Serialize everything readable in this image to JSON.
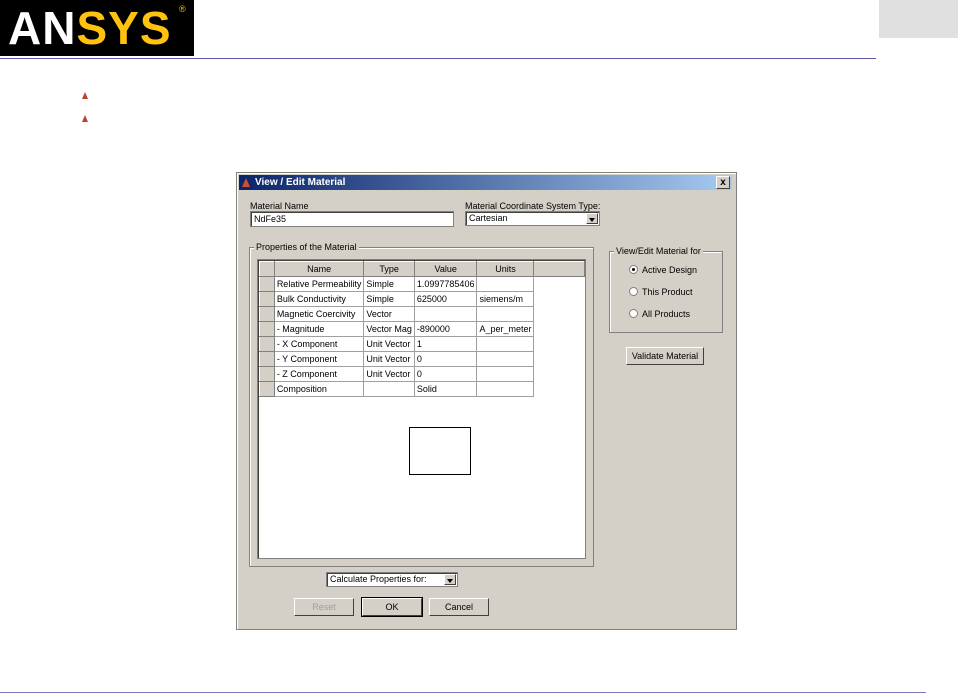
{
  "logo": {
    "an": "AN",
    "sys": "SYS",
    "reg": "®"
  },
  "colors": {
    "accent": "#ffc20e",
    "rule": "#5a5aa8",
    "titlebar": "#0a246a"
  },
  "dialog": {
    "title": "View / Edit Material",
    "close_label": "x",
    "material_name_label": "Material Name",
    "material_name_value": "NdFe35",
    "coord_label": "Material Coordinate System Type:",
    "coord_value": "Cartesian",
    "properties_title": "Properties of the Material",
    "table": {
      "headers": [
        "Name",
        "Type",
        "Value",
        "Units"
      ],
      "rows": [
        {
          "name": "Relative Permeability",
          "type": "Simple",
          "value": "1.0997785406",
          "units": ""
        },
        {
          "name": "Bulk Conductivity",
          "type": "Simple",
          "value": "625000",
          "units": "siemens/m"
        },
        {
          "name": "Magnetic Coercivity",
          "type": "Vector",
          "value": "",
          "units": ""
        },
        {
          "name": "- Magnitude",
          "type": "Vector Mag",
          "value": "-890000",
          "units": "A_per_meter"
        },
        {
          "name": "- X Component",
          "type": "Unit Vector",
          "value": "1",
          "units": ""
        },
        {
          "name": "- Y Component",
          "type": "Unit Vector",
          "value": "0",
          "units": ""
        },
        {
          "name": "- Z Component",
          "type": "Unit Vector",
          "value": "0",
          "units": ""
        },
        {
          "name": "Composition",
          "type": "",
          "value": "Solid",
          "units": ""
        }
      ]
    },
    "view_edit_for": {
      "title": "View/Edit Material for",
      "options": [
        "Active Design",
        "This Product",
        "All Products"
      ],
      "selected": "Active Design"
    },
    "validate_label": "Validate Material",
    "calc_props_label": "Calculate Properties for:",
    "reset_label": "Reset",
    "ok_label": "OK",
    "cancel_label": "Cancel"
  }
}
